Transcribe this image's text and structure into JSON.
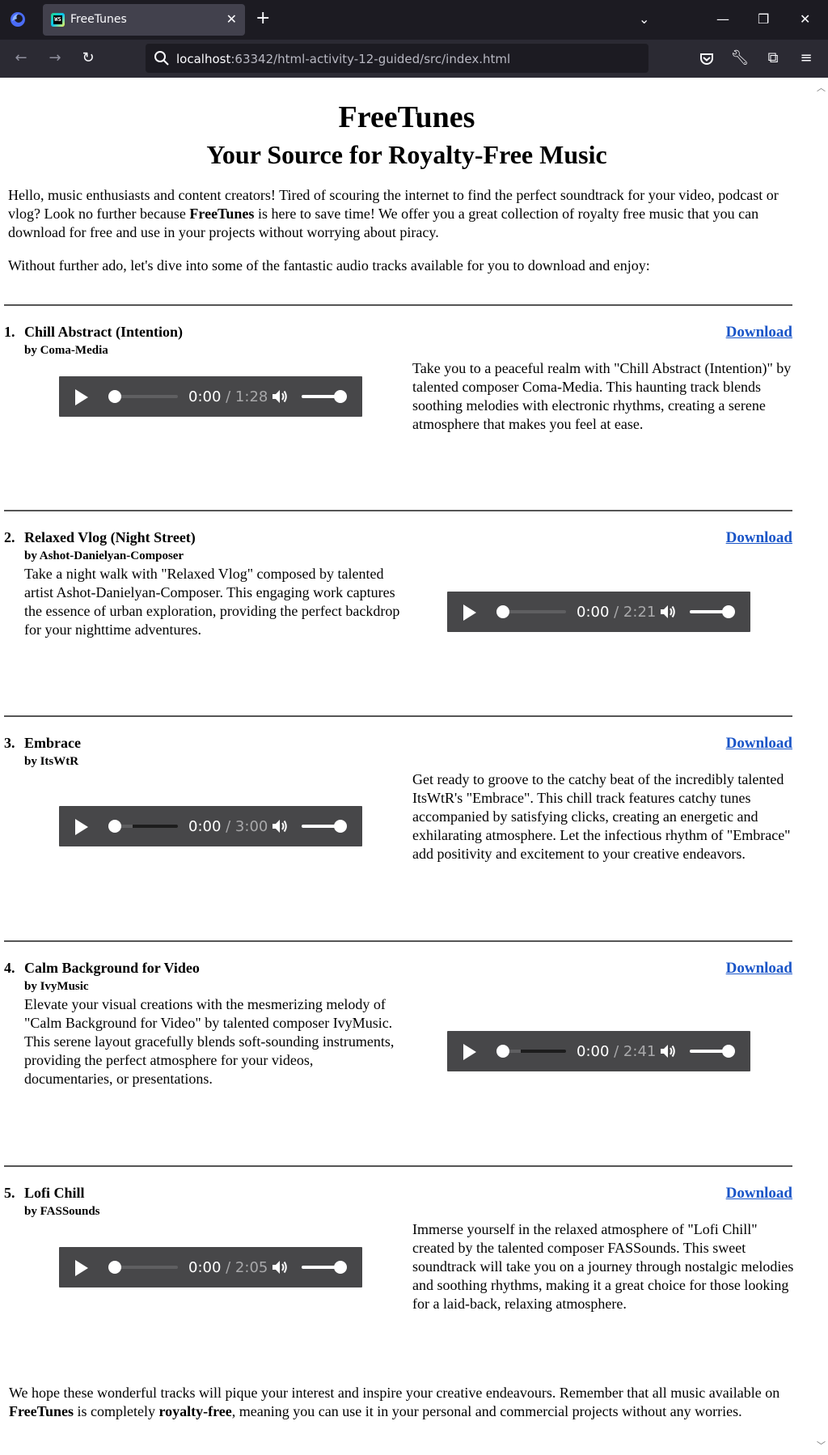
{
  "browser": {
    "tab_title": "FreeTunes",
    "url_host": "localhost",
    "url_rest": ":63342/html-activity-12-guided/src/index.html"
  },
  "page": {
    "title": "FreeTunes",
    "subtitle": "Your Source for Royalty-Free Music",
    "intro_part1": "Hello, music enthusiasts and content creators! Tired of scouring the internet to find the perfect soundtrack for your video, podcast or vlog? Look no further because ",
    "intro_brand": "FreeTunes",
    "intro_part2": " is here to save time! We offer you a great collection of royalty free music that you can download for free and use in your projects without worrying about piracy.",
    "intro2": "Without further ado, let's dive into some of the fantastic audio tracks available for you to download and enjoy:",
    "download_label": "Download",
    "tracks": [
      {
        "num": "1.",
        "title": "Chill Abstract (Intention)",
        "artist": "by Coma-Media",
        "description": "Take you to a peaceful realm with \"Chill Abstract (Intention)\" by talented composer Coma-Media. This haunting track blends soothing melodies with electronic rhythms, creating a serene atmosphere that makes you feel at ease.",
        "time": "0:00",
        "duration": "1:28"
      },
      {
        "num": "2.",
        "title": "Relaxed Vlog (Night Street)",
        "artist": "by Ashot-Danielyan-Composer",
        "description": "Take a night walk with \"Relaxed Vlog\" composed by talented artist Ashot-Danielyan-Composer. This engaging work captures the essence of urban exploration, providing the perfect backdrop for your nighttime adventures.",
        "time": "0:00",
        "duration": "2:21"
      },
      {
        "num": "3.",
        "title": "Embrace",
        "artist": "by ItsWtR",
        "description": "Get ready to groove to the catchy beat of the incredibly talented ItsWtR's \"Embrace\". This chill track features catchy tunes accompanied by satisfying clicks, creating an energetic and exhilarating atmosphere. Let the infectious rhythm of \"Embrace\" add positivity and excitement to your creative endeavors.",
        "time": "0:00",
        "duration": "3:00"
      },
      {
        "num": "4.",
        "title": "Calm Background for Video",
        "artist": "by IvyMusic",
        "description": "Elevate your visual creations with the mesmerizing melody of \"Calm Background for Video\" by talented composer IvyMusic. This serene layout gracefully blends soft-sounding instruments, providing the perfect atmosphere for your videos, documentaries, or presentations.",
        "time": "0:00",
        "duration": "2:41"
      },
      {
        "num": "5.",
        "title": "Lofi Chill",
        "artist": "by FASSounds",
        "description": "Immerse yourself in the relaxed atmosphere of \"Lofi Chill\" created by the talented composer FASSounds. This sweet soundtrack will take you on a journey through nostalgic melodies and soothing rhythms, making it a great choice for those looking for a laid-back, relaxing atmosphere.",
        "time": "0:00",
        "duration": "2:05"
      }
    ],
    "outro_part1": "We hope these wonderful tracks will pique your interest and inspire your creative endeavours. Remember that all music available on ",
    "outro_brand": "FreeTunes",
    "outro_part2": " is completely ",
    "outro_bold2": "royalty-free",
    "outro_part3": ", meaning you can use it in your personal and commercial projects without any worries."
  }
}
